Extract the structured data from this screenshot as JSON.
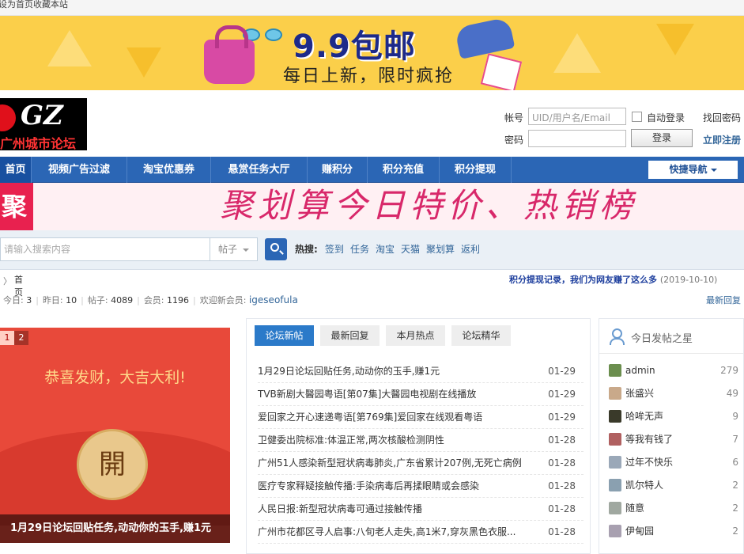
{
  "topbar": {
    "set_home": "设为首页",
    "bookmark": "收藏本站"
  },
  "banner": {
    "title": "9.9包邮",
    "slogan": "每日上新，限时疯抢"
  },
  "logo": {
    "mark": "GZ",
    "name": "广州城市论坛"
  },
  "login": {
    "account_label": "帐号",
    "account_placeholder": "UID/用户名/Email",
    "auto_login": "自动登录",
    "forgot_password": "找回密码",
    "password_label": "密码",
    "login_button": "登录",
    "register": "立即注册"
  },
  "nav": {
    "items": [
      "首页",
      "视频广告过滤",
      "淘宝优惠券",
      "悬赏任务大厅",
      "赚积分",
      "积分充值",
      "积分提现"
    ],
    "quick_nav": "快捷导航"
  },
  "ad": {
    "badge": "聚",
    "text": "聚划算今日特价、热销榜"
  },
  "search": {
    "placeholder": "请输入搜索内容",
    "scope": "帖子",
    "hot_label": "热搜:",
    "hot_keywords": [
      "签到",
      "任务",
      "淘宝",
      "天猫",
      "聚划算",
      "返利"
    ]
  },
  "breadcrumb": {
    "home": "首页"
  },
  "notice": {
    "text": "积分提现记录，我们为网友赚了这么多",
    "date": "(2019-10-10)"
  },
  "stats": {
    "today_label": "今日:",
    "today": "3",
    "yesterday_label": "昨日:",
    "yesterday": "10",
    "posts_label": "帖子:",
    "posts": "4089",
    "members_label": "会员:",
    "members": "1196",
    "welcome_label": "欢迎新会员:",
    "new_member": "igeseofula",
    "latest_reply": "最新回复"
  },
  "slider": {
    "pages": [
      "1",
      "2"
    ],
    "greeting": "恭喜发财，大吉大利!",
    "open": "開",
    "caption": "1月29日论坛回贴任务,动动你的玉手,赚1元"
  },
  "threads": {
    "tabs": [
      "论坛新帖",
      "最新回复",
      "本月热点",
      "论坛精华"
    ],
    "rows": [
      {
        "title": "1月29日论坛回贴任务,动动你的玉手,赚1元",
        "date": "01-29"
      },
      {
        "title": "TVB新剧大醫园粤语[第07集]大醫园电视剧在线播放",
        "date": "01-29"
      },
      {
        "title": "爱回家之开心速递粤语[第769集]爱回家在线观看粤语",
        "date": "01-29"
      },
      {
        "title": "卫健委出院标准:体温正常,两次核酸检测阴性",
        "date": "01-28"
      },
      {
        "title": "广州51人感染新型冠状病毒肺炎,广东省累计207例,无死亡病例",
        "date": "01-28"
      },
      {
        "title": "医疗专家释疑接触传播:手染病毒后再揉眼睛或会感染",
        "date": "01-28"
      },
      {
        "title": "人民日报:新型冠状病毒可通过接触传播",
        "date": "01-28"
      },
      {
        "title": "广州市花都区寻人启事:八旬老人走失,高1米7,穿灰黑色衣服...",
        "date": "01-28"
      }
    ]
  },
  "stars": {
    "title": "今日发帖之星",
    "users": [
      {
        "name": "admin",
        "count": "279",
        "color": "#6b8e4e"
      },
      {
        "name": "张盛兴",
        "count": "49",
        "color": "#c9a98a"
      },
      {
        "name": "哈哞无声",
        "count": "9",
        "color": "#3a3a2a"
      },
      {
        "name": "等我有钱了",
        "count": "7",
        "color": "#b06060"
      },
      {
        "name": "过年不快乐",
        "count": "6",
        "color": "#9aa8b8"
      },
      {
        "name": "凯尔特人",
        "count": "2",
        "color": "#8aa0b0"
      },
      {
        "name": "随意",
        "count": "2",
        "color": "#a0a8a0"
      },
      {
        "name": "伊甸园",
        "count": "2",
        "color": "#a8a0b0"
      }
    ]
  }
}
